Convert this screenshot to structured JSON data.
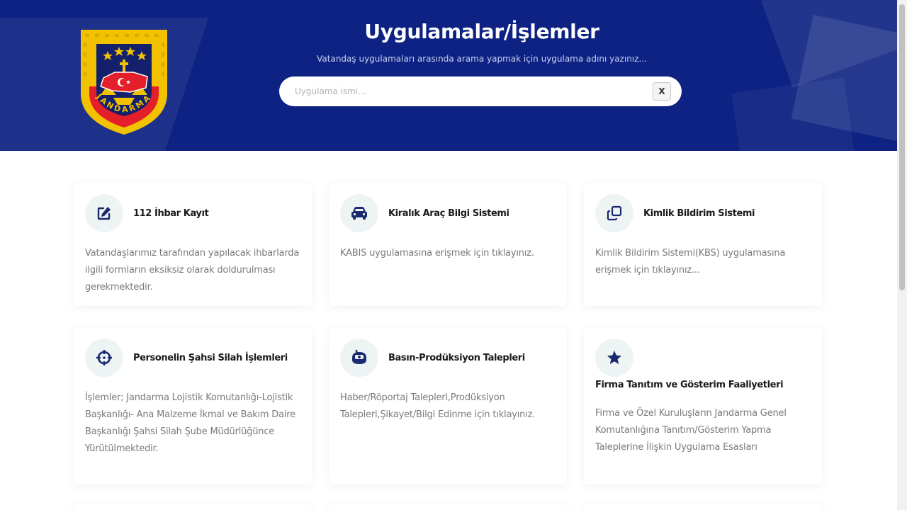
{
  "header": {
    "title": "Uygulamalar/İşlemler",
    "subtitle": "Vatandaş uygulamaları arasında arama yapmak için uygulama adını yazınız...",
    "search_placeholder": "Uygulama ismi...",
    "clear_label": "X"
  },
  "logo": {
    "text": "JANDARMA",
    "colors": {
      "gold": "#f2c200",
      "red": "#e3202a",
      "navy": "#14206b"
    }
  },
  "cards": [
    {
      "title": "112 İhbar Kayıt",
      "icon": "edit-icon",
      "desc": "Vatandaşlarımız tarafından yapılacak ihbarlarda ilgili formların eksiksiz olarak doldurulması gerekmektedir."
    },
    {
      "title": "Kiralık Araç Bilgi Sistemi",
      "icon": "car-icon",
      "desc": "KABIS uygulamasına erişmek için tıklayınız."
    },
    {
      "title": "Kimlik Bildirim Sistemi",
      "icon": "copy-icon",
      "desc": "Kimlik Bildirim Sistemi(KBS) uygulamasına erişmek için tıklayınız..."
    },
    {
      "title": "Personelin Şahsi Silah İşlemleri",
      "icon": "crosshair-icon",
      "desc": "İşlemler; Jandarma Lojistik Komutanlığı-Lojistik Başkanlığı- Ana Malzeme İkmal ve Bakım Daire Başkanlığı Şahsi Silah Şube Müdürlüğünce Yürütülmektedir."
    },
    {
      "title": "Basın-Prodüksiyon Talepleri",
      "icon": "press-icon",
      "desc": "Haber/Röportaj Talepleri,Prodüksiyon Talepleri,Şikayet/Bilgi Edinme için tıklayınız."
    },
    {
      "title": "Firma Tanıtım ve Gösterim Faaliyetleri",
      "icon": "star-badge-icon",
      "desc": "Firma ve Özel Kuruluşların Jandarma Genel Komutanlığına Tanıtım/Gösterim Yapma Taleplerine İlişkin Uygulama Esasları"
    }
  ],
  "colors": {
    "header_bg": "#0d2282",
    "icon_color": "#1a2a6e",
    "icon_bg": "#eef4f4"
  }
}
